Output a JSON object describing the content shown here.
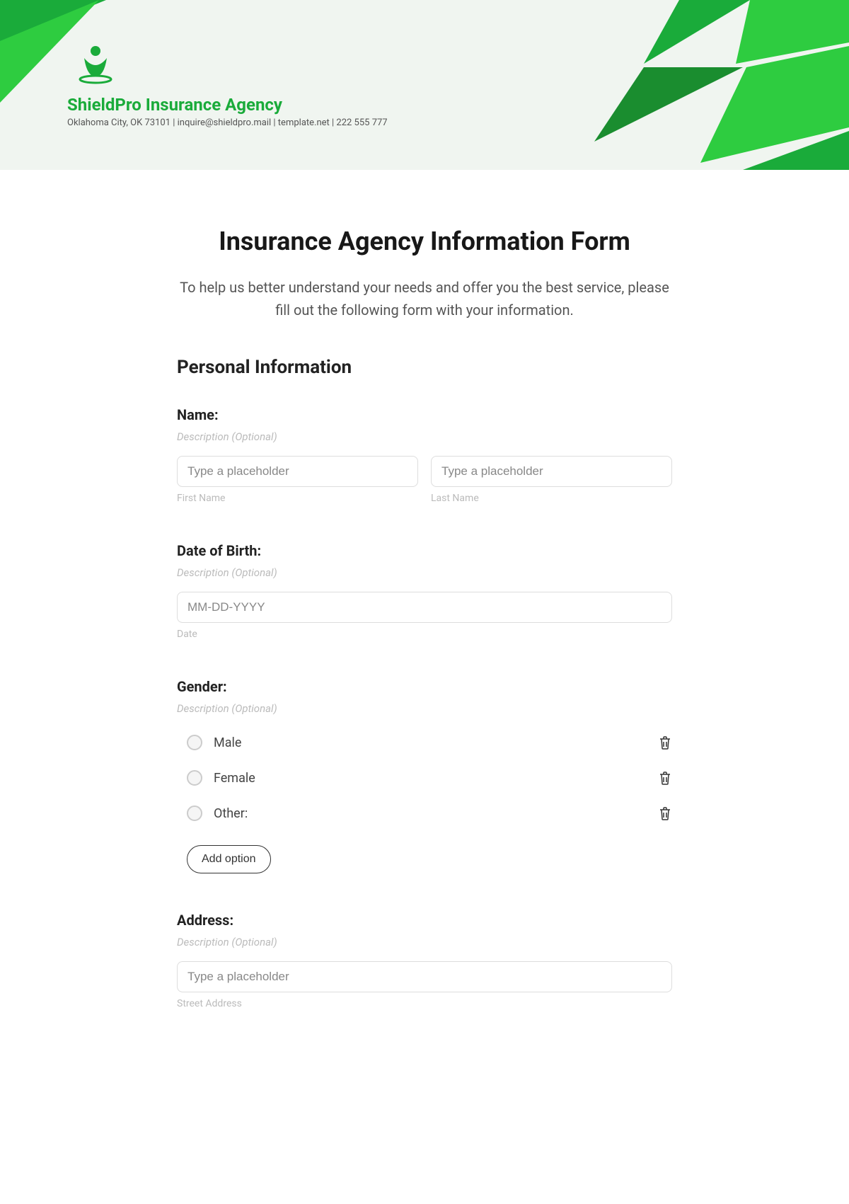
{
  "header": {
    "company_name": "ShieldPro Insurance Agency",
    "contact_line": "Oklahoma City, OK 73101 | inquire@shieldpro.mail | template.net | 222 555 777"
  },
  "form": {
    "title": "Insurance Agency Information Form",
    "intro": "To help us better understand your needs and offer you the best service, please fill out the following form with your information.",
    "section_title": "Personal Information",
    "name": {
      "label": "Name:",
      "description": "Description (Optional)",
      "first_placeholder": "Type a placeholder",
      "first_sublabel": "First Name",
      "last_placeholder": "Type a placeholder",
      "last_sublabel": "Last Name"
    },
    "dob": {
      "label": "Date of Birth:",
      "description": "Description (Optional)",
      "placeholder": "MM-DD-YYYY",
      "sublabel": "Date"
    },
    "gender": {
      "label": "Gender:",
      "description": "Description (Optional)",
      "options": [
        "Male",
        "Female",
        "Other:"
      ],
      "add_option_label": "Add option"
    },
    "address": {
      "label": "Address:",
      "description": "Description (Optional)",
      "street_placeholder": "Type a placeholder",
      "street_sublabel": "Street Address"
    }
  }
}
